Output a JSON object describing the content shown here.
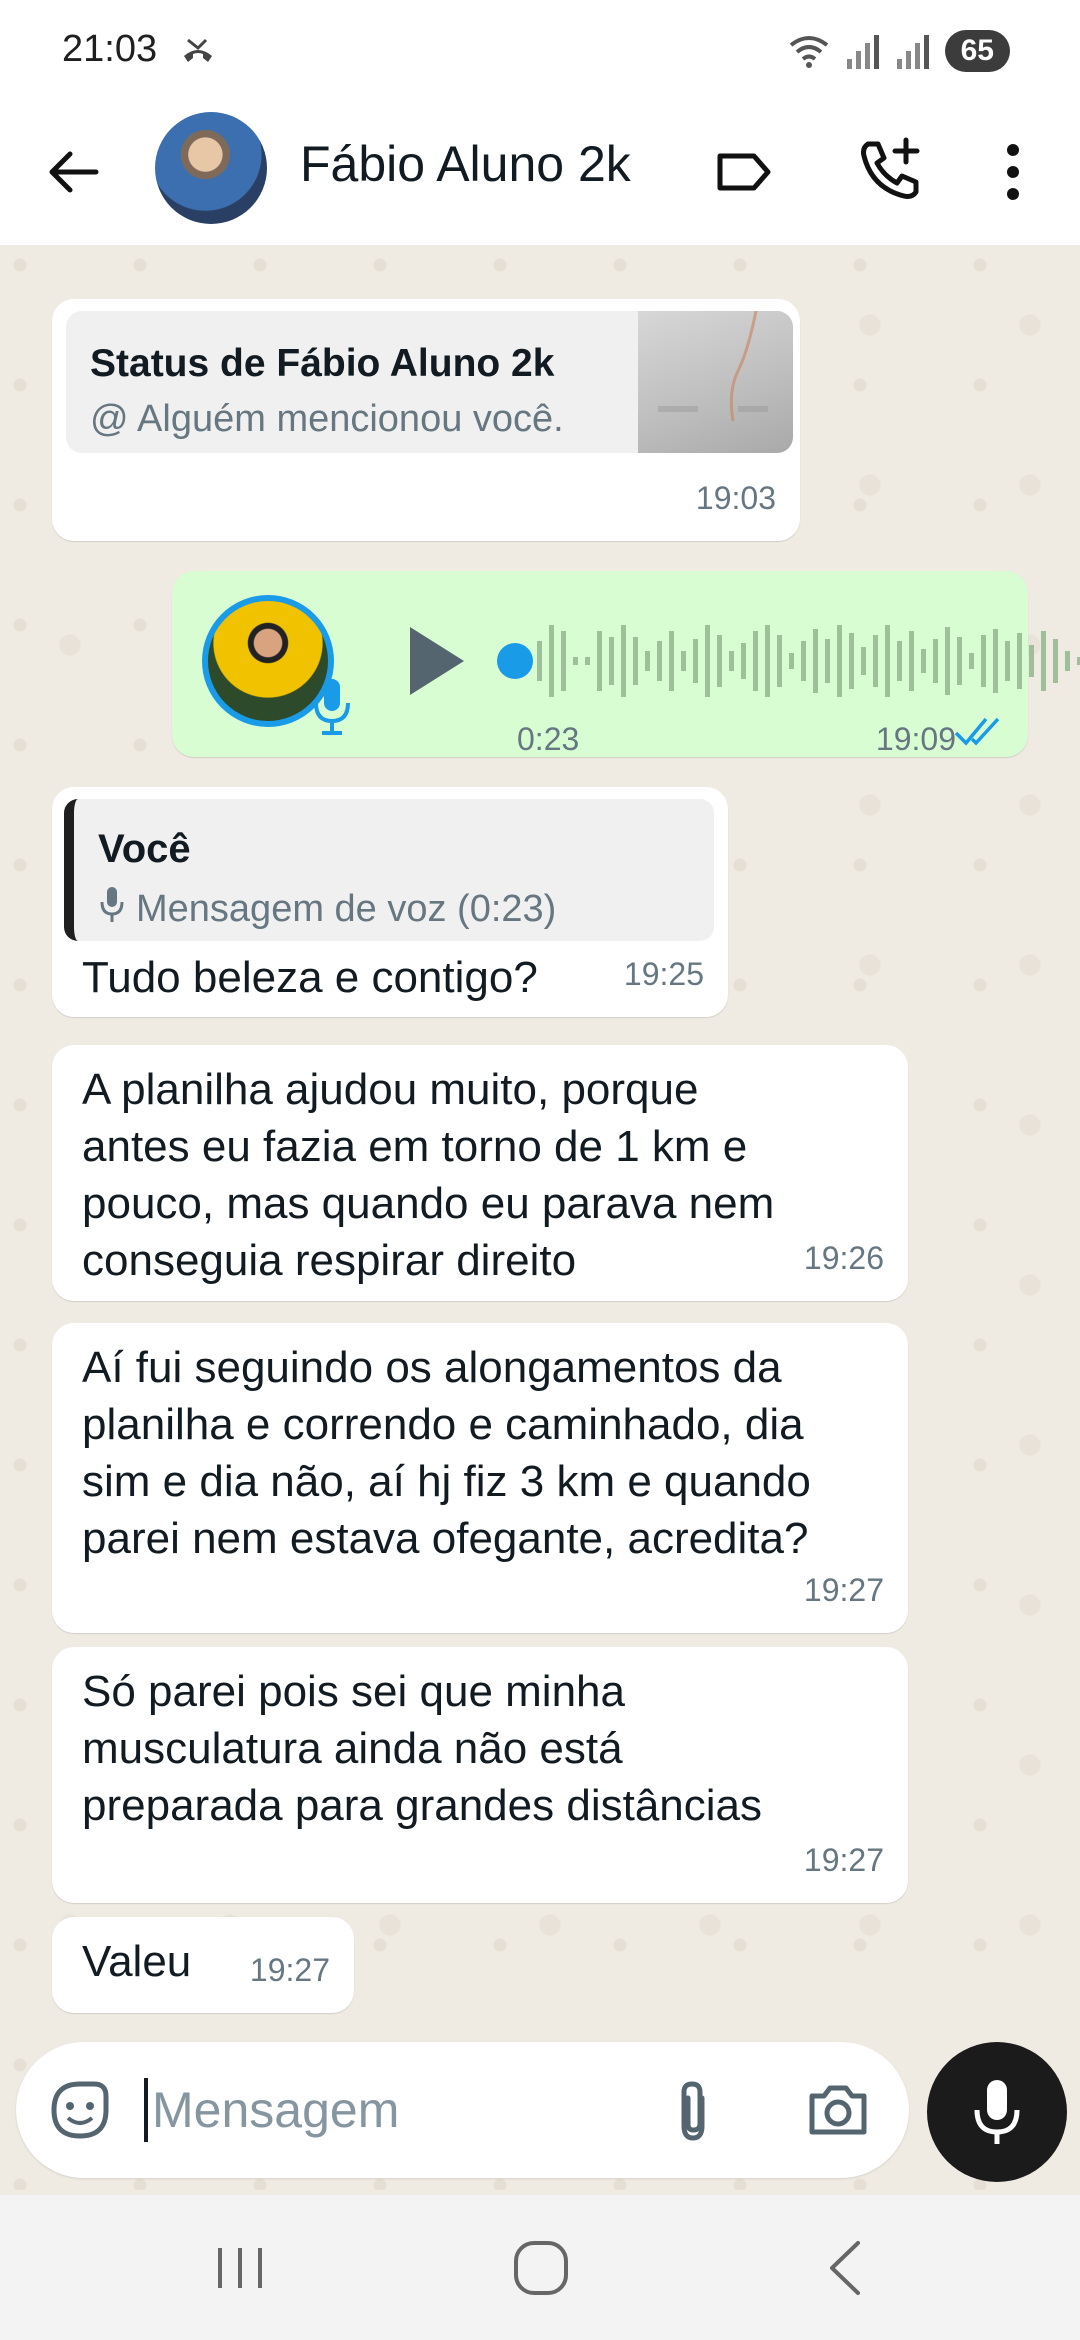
{
  "status_bar": {
    "time": "21:03",
    "battery": "65",
    "icons": [
      "missed-call-icon",
      "wifi-icon",
      "signal-icon",
      "signal-icon"
    ]
  },
  "header": {
    "contact_name": "Fábio Aluno 2k",
    "icons": [
      "back-arrow-icon",
      "label-icon",
      "add-call-icon",
      "more-vert-icon"
    ]
  },
  "messages": [
    {
      "type": "status_reply",
      "direction": "incoming",
      "status_title": "Status de Fábio Aluno 2k",
      "status_subtitle": "@ Alguém mencionou você.",
      "time": "19:03"
    },
    {
      "type": "voice",
      "direction": "outgoing",
      "duration": "0:23",
      "time": "19:09",
      "read": true
    },
    {
      "type": "reply",
      "direction": "incoming",
      "quote_author": "Você",
      "quote_text": "Mensagem de voz (0:23)",
      "text": "Tudo beleza e contigo?",
      "time": "19:25"
    },
    {
      "type": "text",
      "direction": "incoming",
      "lines": [
        "A planilha ajudou muito, porque",
        "antes eu fazia em torno de 1 km e",
        "pouco, mas quando eu parava nem",
        "conseguia respirar direito"
      ],
      "time": "19:26"
    },
    {
      "type": "text",
      "direction": "incoming",
      "lines": [
        "Aí fui seguindo os alongamentos da",
        "planilha e correndo e caminhado, dia",
        "sim e dia não, aí hj fiz 3 km e quando",
        "parei nem estava ofegante, acredita?"
      ],
      "time": "19:27"
    },
    {
      "type": "text",
      "direction": "incoming",
      "lines": [
        "Só parei pois sei que minha",
        "musculatura ainda não está",
        "preparada para grandes distâncias"
      ],
      "time": "19:27"
    },
    {
      "type": "text",
      "direction": "incoming",
      "lines": [
        "Valeu"
      ],
      "time": "19:27"
    }
  ],
  "input": {
    "placeholder": "Mensagem",
    "value": ""
  },
  "colors": {
    "chat_background": "#efeae2",
    "outgoing_bubble": "#d9fdd3",
    "incoming_bubble": "#ffffff",
    "accent_blue": "#1a9be8"
  }
}
